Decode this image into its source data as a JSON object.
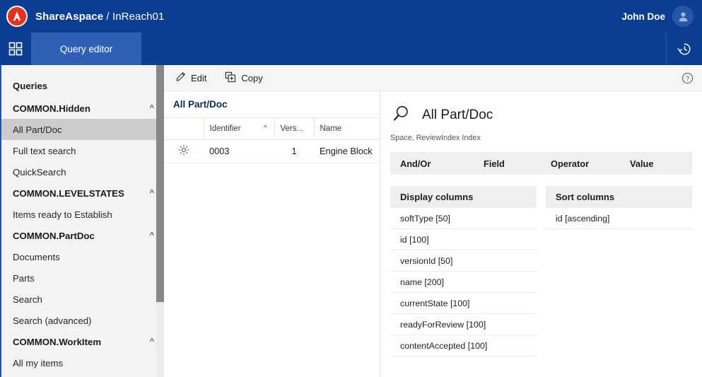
{
  "brand": {
    "app_name": "ShareAspace",
    "separator": "/",
    "instance": "InReach01",
    "logo_letter": "A",
    "logo_color": "#e8301c",
    "bar_color": "#0b3d91"
  },
  "user": {
    "name": "John Doe",
    "avatar_icon": "person-icon"
  },
  "nav": {
    "waffle_icon": "app-grid-icon",
    "history_icon": "history-clock-icon",
    "tabs": [
      {
        "label": "Query editor",
        "active": true
      }
    ]
  },
  "sidebar": {
    "heading": "Queries",
    "scroll_thumb_percent": 76,
    "groups": [
      {
        "label": "COMMON.Hidden",
        "expanded": true,
        "chevron": "chevron-up-icon",
        "items": [
          {
            "label": "All Part/Doc",
            "active": true
          },
          {
            "label": "Full text search",
            "active": false
          },
          {
            "label": "QuickSearch",
            "active": false
          }
        ]
      },
      {
        "label": "COMMON.LEVELSTATES",
        "expanded": true,
        "chevron": "chevron-up-icon",
        "items": [
          {
            "label": "Items ready to Establish",
            "active": false
          }
        ]
      },
      {
        "label": "COMMON.PartDoc",
        "expanded": true,
        "chevron": "chevron-up-icon",
        "items": [
          {
            "label": "Documents",
            "active": false
          },
          {
            "label": "Parts",
            "active": false
          },
          {
            "label": "Search",
            "active": false
          },
          {
            "label": "Search (advanced)",
            "active": false
          }
        ]
      },
      {
        "label": "COMMON.WorkItem",
        "expanded": true,
        "chevron": "chevron-up-icon",
        "items": [
          {
            "label": "All my items",
            "active": false
          }
        ]
      }
    ]
  },
  "toolbar": {
    "edit_label": "Edit",
    "edit_icon": "pencil-icon",
    "copy_label": "Copy",
    "copy_icon": "copy-add-icon",
    "help_icon": "help-circle-icon"
  },
  "results": {
    "title": "All Part/Doc",
    "columns": [
      {
        "label": "",
        "key": "gear"
      },
      {
        "label": "Identifier",
        "key": "identifier",
        "sorted": true,
        "sort_icon": "chevron-up-icon"
      },
      {
        "label": "Vers...",
        "key": "version"
      },
      {
        "label": "Name",
        "key": "name"
      }
    ],
    "rows": [
      {
        "gear_icon": "gear-icon",
        "identifier": "0003",
        "version": "1",
        "name": "Engine Block"
      }
    ]
  },
  "detail": {
    "search_icon": "search-icon",
    "title": "All Part/Doc",
    "subtitle": "Space, ReviewIndex Index",
    "criteria_header": {
      "andor": "And/Or",
      "field": "Field",
      "operator": "Operator",
      "value": "Value"
    },
    "criteria_rows": [],
    "display_columns": {
      "header": "Display columns",
      "items": [
        "softType [50]",
        "id [100]",
        "versionId [50]",
        "name [200]",
        "currentState [100]",
        "readyForReview [100]",
        "contentAccepted [100]"
      ]
    },
    "sort_columns": {
      "header": "Sort columns",
      "items": [
        "id [ascending]"
      ]
    }
  }
}
